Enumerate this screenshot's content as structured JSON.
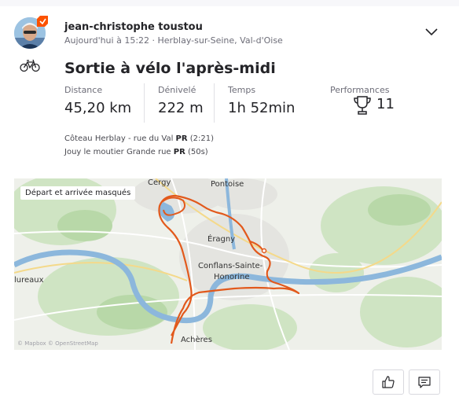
{
  "athlete": {
    "name": "jean-christophe toustou",
    "meta": "Aujourd'hui à 15:22 · Herblay-sur-Seine, Val-d'Oise"
  },
  "activity": {
    "type_icon": "bike-icon",
    "title": "Sortie à vélo l'après-midi"
  },
  "stats": [
    {
      "label": "Distance",
      "value": "45,20 km"
    },
    {
      "label": "Dénivelé",
      "value": "222 m"
    },
    {
      "label": "Temps",
      "value": "1h 52min"
    }
  ],
  "performances": {
    "label": "Performances",
    "icon": "trophy-icon",
    "value": "11"
  },
  "segments": [
    {
      "name": "Côteau Herblay - rue du Val",
      "badge": "PR",
      "time": "(2:21)"
    },
    {
      "name": "Jouy le moutier Grande rue",
      "badge": "PR",
      "time": "(50s)"
    }
  ],
  "map": {
    "badge": "Départ et arrivée masqués",
    "labels": [
      "Cergy",
      "Pontoise",
      "Éragny",
      "Conflans-Sainte-",
      "Honorine",
      "lureaux",
      "Achères"
    ],
    "attribution": "© Mapbox © OpenStreetMap",
    "route_color": "#e2591c"
  },
  "colors": {
    "accent": "#fc5200"
  }
}
